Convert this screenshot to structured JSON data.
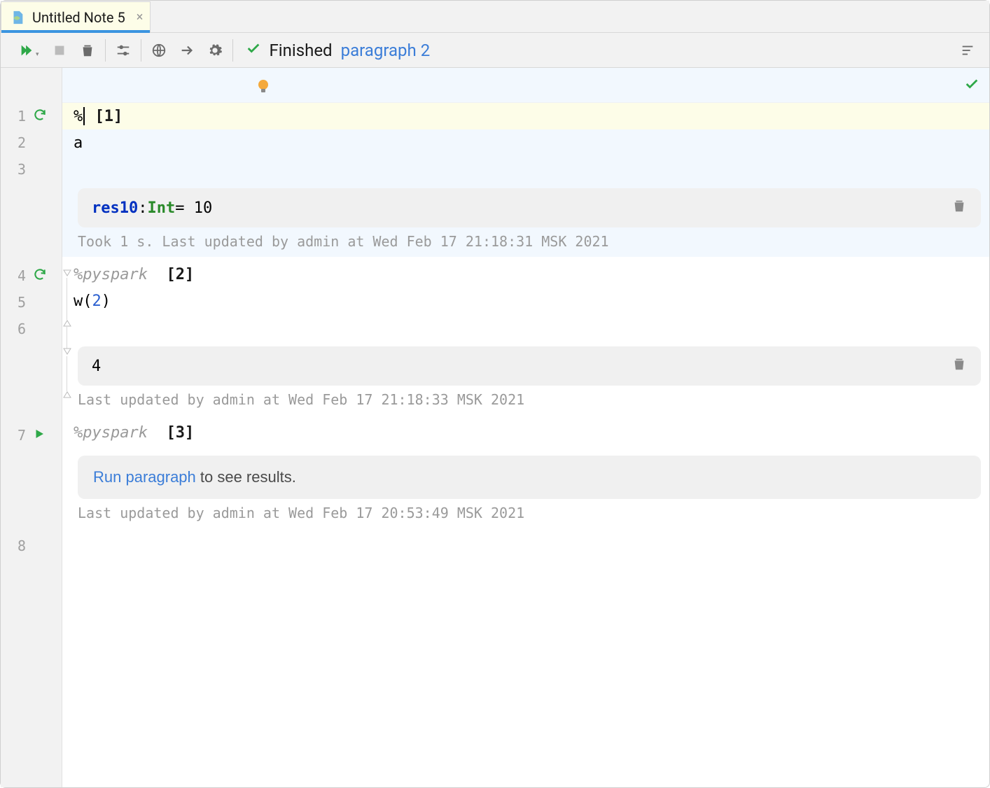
{
  "tab": {
    "title": "Untitled Note 5"
  },
  "status": {
    "label": "Finished",
    "link": "paragraph 2"
  },
  "gutter": {
    "l1": "1",
    "l2": "2",
    "l3": "3",
    "l4": "4",
    "l5": "5",
    "l6": "6",
    "l7": "7",
    "l8": "8"
  },
  "para1": {
    "prefix": "%",
    "tag": "[1]",
    "code_line2": "a",
    "result_name": "res10",
    "result_colon": ": ",
    "result_type": "Int",
    "result_rest": " = 10",
    "meta": "Took 1 s. Last updated by admin at Wed Feb 17 21:18:31 MSK 2021"
  },
  "para2": {
    "interpreter": "%pyspark",
    "tag": "[2]",
    "code_fn": "w(",
    "code_arg": "2",
    "code_close": ")",
    "result": "4",
    "meta": "Last updated by admin at Wed Feb 17 21:18:33 MSK 2021"
  },
  "para3": {
    "interpreter": "%pyspark",
    "tag": "[3]",
    "prompt_link": "Run paragraph",
    "prompt_rest": " to see results.",
    "meta": "Last updated by admin at Wed Feb 17 20:53:49 MSK 2021"
  }
}
